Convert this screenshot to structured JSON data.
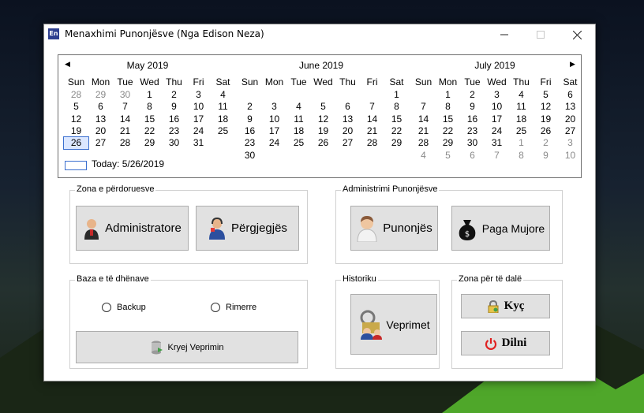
{
  "window": {
    "title": "Menaxhimi Punonjësve (Nga Edison Neza)",
    "app_icon_text": "En"
  },
  "calendar": {
    "weekdays": [
      "Sun",
      "Mon",
      "Tue",
      "Wed",
      "Thu",
      "Fri",
      "Sat"
    ],
    "months": [
      {
        "title": "May 2019",
        "weeks": [
          [
            [
              "28",
              1
            ],
            [
              "29",
              1
            ],
            [
              "30",
              1
            ],
            [
              "1",
              0
            ],
            [
              "2",
              0
            ],
            [
              "3",
              0
            ],
            [
              "4",
              0
            ]
          ],
          [
            [
              "5",
              0
            ],
            [
              "6",
              0
            ],
            [
              "7",
              0
            ],
            [
              "8",
              0
            ],
            [
              "9",
              0
            ],
            [
              "10",
              0
            ],
            [
              "11",
              0
            ]
          ],
          [
            [
              "12",
              0
            ],
            [
              "13",
              0
            ],
            [
              "14",
              0
            ],
            [
              "15",
              0
            ],
            [
              "16",
              0
            ],
            [
              "17",
              0
            ],
            [
              "18",
              0
            ]
          ],
          [
            [
              "19",
              0
            ],
            [
              "20",
              0
            ],
            [
              "21",
              0
            ],
            [
              "22",
              0
            ],
            [
              "23",
              0
            ],
            [
              "24",
              0
            ],
            [
              "25",
              0
            ]
          ],
          [
            [
              "26",
              2
            ],
            [
              "27",
              0
            ],
            [
              "28",
              0
            ],
            [
              "29",
              0
            ],
            [
              "30",
              0
            ],
            [
              "31",
              0
            ],
            [
              "",
              0
            ]
          ],
          [
            [
              "",
              0
            ],
            [
              "",
              0
            ],
            [
              "",
              0
            ],
            [
              "",
              0
            ],
            [
              "",
              0
            ],
            [
              "",
              0
            ],
            [
              "",
              0
            ]
          ]
        ]
      },
      {
        "title": "June 2019",
        "weeks": [
          [
            [
              "",
              0
            ],
            [
              "",
              0
            ],
            [
              "",
              0
            ],
            [
              "",
              0
            ],
            [
              "",
              0
            ],
            [
              "",
              0
            ],
            [
              "1",
              0
            ]
          ],
          [
            [
              "2",
              0
            ],
            [
              "3",
              0
            ],
            [
              "4",
              0
            ],
            [
              "5",
              0
            ],
            [
              "6",
              0
            ],
            [
              "7",
              0
            ],
            [
              "8",
              0
            ]
          ],
          [
            [
              "9",
              0
            ],
            [
              "10",
              0
            ],
            [
              "11",
              0
            ],
            [
              "12",
              0
            ],
            [
              "13",
              0
            ],
            [
              "14",
              0
            ],
            [
              "15",
              0
            ]
          ],
          [
            [
              "16",
              0
            ],
            [
              "17",
              0
            ],
            [
              "18",
              0
            ],
            [
              "19",
              0
            ],
            [
              "20",
              0
            ],
            [
              "21",
              0
            ],
            [
              "22",
              0
            ]
          ],
          [
            [
              "23",
              0
            ],
            [
              "24",
              0
            ],
            [
              "25",
              0
            ],
            [
              "26",
              0
            ],
            [
              "27",
              0
            ],
            [
              "28",
              0
            ],
            [
              "29",
              0
            ]
          ],
          [
            [
              "30",
              0
            ],
            [
              "",
              0
            ],
            [
              "",
              0
            ],
            [
              "",
              0
            ],
            [
              "",
              0
            ],
            [
              "",
              0
            ],
            [
              "",
              0
            ]
          ]
        ]
      },
      {
        "title": "July 2019",
        "weeks": [
          [
            [
              "",
              0
            ],
            [
              "1",
              0
            ],
            [
              "2",
              0
            ],
            [
              "3",
              0
            ],
            [
              "4",
              0
            ],
            [
              "5",
              0
            ],
            [
              "6",
              0
            ]
          ],
          [
            [
              "7",
              0
            ],
            [
              "8",
              0
            ],
            [
              "9",
              0
            ],
            [
              "10",
              0
            ],
            [
              "11",
              0
            ],
            [
              "12",
              0
            ],
            [
              "13",
              0
            ]
          ],
          [
            [
              "14",
              0
            ],
            [
              "15",
              0
            ],
            [
              "16",
              0
            ],
            [
              "17",
              0
            ],
            [
              "18",
              0
            ],
            [
              "19",
              0
            ],
            [
              "20",
              0
            ]
          ],
          [
            [
              "21",
              0
            ],
            [
              "22",
              0
            ],
            [
              "23",
              0
            ],
            [
              "24",
              0
            ],
            [
              "25",
              0
            ],
            [
              "26",
              0
            ],
            [
              "27",
              0
            ]
          ],
          [
            [
              "28",
              0
            ],
            [
              "29",
              0
            ],
            [
              "30",
              0
            ],
            [
              "31",
              0
            ],
            [
              "1",
              1
            ],
            [
              "2",
              1
            ],
            [
              "3",
              1
            ]
          ],
          [
            [
              "4",
              1
            ],
            [
              "5",
              1
            ],
            [
              "6",
              1
            ],
            [
              "7",
              1
            ],
            [
              "8",
              1
            ],
            [
              "9",
              1
            ],
            [
              "10",
              1
            ]
          ]
        ]
      }
    ],
    "today_label": "Today: 5/26/2019"
  },
  "groups": {
    "users": {
      "label": "Zona e përdoruesve",
      "admin_button": "Administratore",
      "responsible_button": "Përgjegjës"
    },
    "employees": {
      "label": "Administrimi Punonjësve",
      "employee_button": "Punonjës",
      "salary_button": "Paga Mujore"
    },
    "database": {
      "label": "Baza e të dhënave",
      "backup_label": "Backup",
      "restore_label": "Rimerre",
      "create_button": "Kryej Veprimin"
    },
    "history": {
      "label": "Historiku",
      "actions_button": "Veprimet"
    },
    "exit": {
      "label": "Zona për të dalë",
      "lock_button": "Kyç",
      "exit_button": "Dilni"
    }
  },
  "colors": {
    "accent": "#3b6fcf",
    "power_red": "#e02020"
  }
}
